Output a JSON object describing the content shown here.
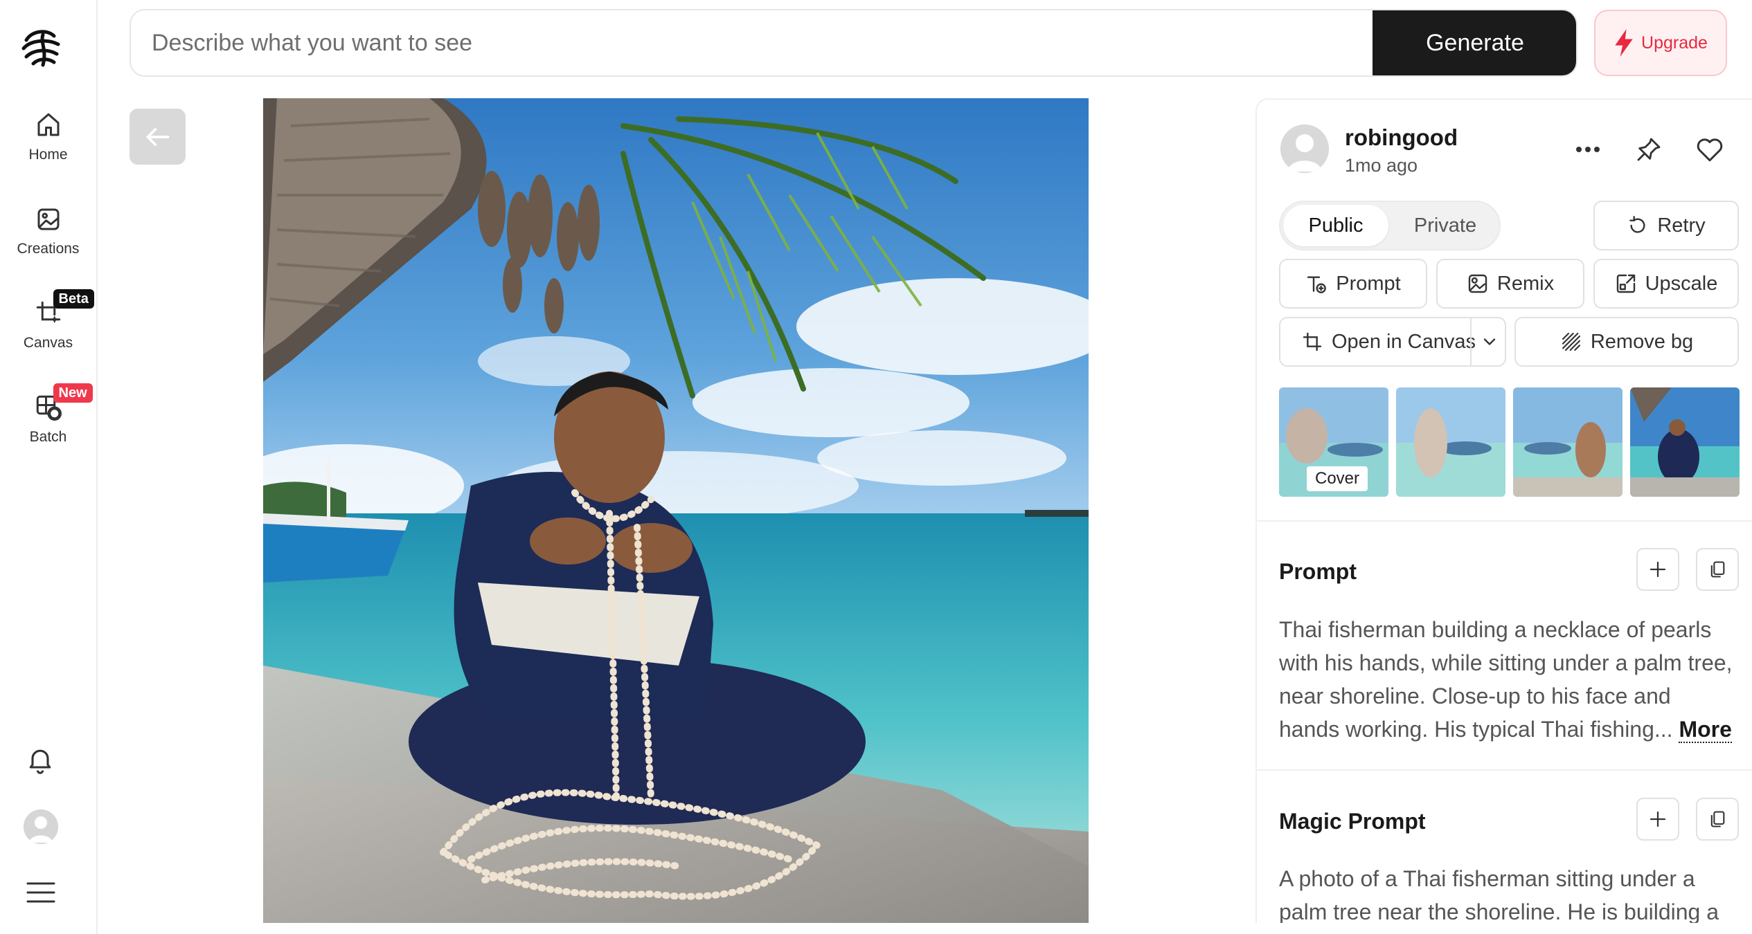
{
  "sidebar": {
    "items": [
      {
        "label": "Home",
        "icon": "home-icon"
      },
      {
        "label": "Creations",
        "icon": "image-icon"
      },
      {
        "label": "Canvas",
        "icon": "canvas-icon",
        "badge": "Beta"
      },
      {
        "label": "Batch",
        "icon": "batch-icon",
        "badge": "New"
      }
    ]
  },
  "search": {
    "placeholder": "Describe what you want to see",
    "generate_label": "Generate"
  },
  "upgrade_label": "Upgrade",
  "post": {
    "username": "robingood",
    "time_ago": "1mo ago",
    "visibility": {
      "public": "Public",
      "private": "Private",
      "selected": "Public"
    },
    "actions": {
      "retry": "Retry",
      "prompt": "Prompt",
      "remix": "Remix",
      "upscale": "Upscale",
      "open_in_canvas": "Open in Canvas",
      "remove_bg": "Remove bg"
    },
    "thumbnails": {
      "cover_label": "Cover"
    },
    "prompt_section": {
      "title": "Prompt",
      "text": "Thai fisherman building a necklace of pearls with his hands, while sitting under a palm tree, near shoreline. Close-up to his face and hands working. His typical Thai fishing...",
      "more_label": "More"
    },
    "magic_prompt_section": {
      "title": "Magic Prompt",
      "text": "A photo of a Thai fisherman sitting under a palm tree near the shoreline. He is building a"
    }
  },
  "colors": {
    "accent_red": "#e8293e",
    "new_badge": "#f0384c",
    "dark": "#1b1b1b"
  }
}
